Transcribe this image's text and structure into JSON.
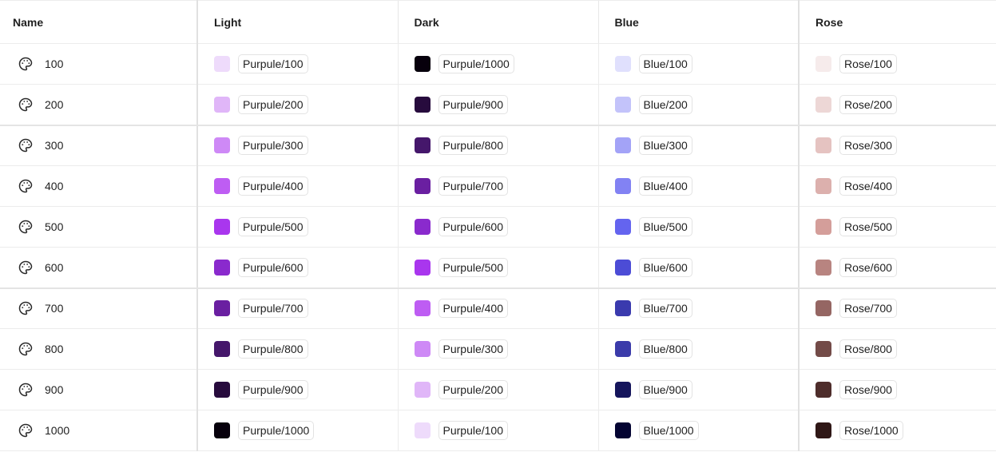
{
  "headers": [
    "Name",
    "Light",
    "Dark",
    "Blue",
    "Rose"
  ],
  "icon": "palette-icon",
  "rows": [
    {
      "name": "100",
      "light": {
        "label": "Purpule/100",
        "color": "#EEDBFB"
      },
      "dark": {
        "label": "Purpule/1000",
        "color": "#07000C"
      },
      "blue": {
        "label": "Blue/100",
        "color": "#E0E0FD"
      },
      "rose": {
        "label": "Rose/100",
        "color": "#F6EBEB"
      }
    },
    {
      "name": "200",
      "light": {
        "label": "Purpule/200",
        "color": "#E0B6F8"
      },
      "dark": {
        "label": "Purpule/900",
        "color": "#270B3D"
      },
      "blue": {
        "label": "Blue/200",
        "color": "#C3C3FA"
      },
      "rose": {
        "label": "Rose/200",
        "color": "#EDD7D6"
      }
    },
    {
      "name": "300",
      "light": {
        "label": "Purpule/300",
        "color": "#CE89F6"
      },
      "dark": {
        "label": "Purpule/800",
        "color": "#45176B"
      },
      "blue": {
        "label": "Blue/300",
        "color": "#A3A3F7"
      },
      "rose": {
        "label": "Rose/300",
        "color": "#E5C3C1"
      }
    },
    {
      "name": "400",
      "light": {
        "label": "Purpule/400",
        "color": "#BE5DF3"
      },
      "dark": {
        "label": "Purpule/700",
        "color": "#6A1FA1"
      },
      "blue": {
        "label": "Blue/400",
        "color": "#8282F3"
      },
      "rose": {
        "label": "Rose/400",
        "color": "#DCB0AD"
      }
    },
    {
      "name": "500",
      "light": {
        "label": "Purpule/500",
        "color": "#A936EE"
      },
      "dark": {
        "label": "Purpule/600",
        "color": "#8A2ACD"
      },
      "blue": {
        "label": "Blue/500",
        "color": "#6464EF"
      },
      "rose": {
        "label": "Rose/500",
        "color": "#D49E9A"
      }
    },
    {
      "name": "600",
      "light": {
        "label": "Purpule/600",
        "color": "#8A2ACD"
      },
      "dark": {
        "label": "Purpule/500",
        "color": "#A936EE"
      },
      "blue": {
        "label": "Blue/600",
        "color": "#4C4CD6"
      },
      "rose": {
        "label": "Rose/600",
        "color": "#B88480"
      }
    },
    {
      "name": "700",
      "light": {
        "label": "Purpule/700",
        "color": "#6A1FA1"
      },
      "dark": {
        "label": "Purpule/400",
        "color": "#BE5DF3"
      },
      "blue": {
        "label": "Blue/700",
        "color": "#3A3AAE"
      },
      "rose": {
        "label": "Rose/700",
        "color": "#956663"
      }
    },
    {
      "name": "800",
      "light": {
        "label": "Purpule/800",
        "color": "#45176B"
      },
      "dark": {
        "label": "Purpule/300",
        "color": "#CE89F6"
      },
      "blue": {
        "label": "Blue/800",
        "color": "#3B3BAA"
      },
      "rose": {
        "label": "Rose/800",
        "color": "#734B48"
      }
    },
    {
      "name": "900",
      "light": {
        "label": "Purpule/900",
        "color": "#270B3D"
      },
      "dark": {
        "label": "Purpule/200",
        "color": "#E0B6F8"
      },
      "blue": {
        "label": "Blue/900",
        "color": "#15155C"
      },
      "rose": {
        "label": "Rose/900",
        "color": "#4E2D2B"
      }
    },
    {
      "name": "1000",
      "light": {
        "label": "Purpule/1000",
        "color": "#07000C"
      },
      "dark": {
        "label": "Purpule/100",
        "color": "#EEDBFB"
      },
      "blue": {
        "label": "Blue/1000",
        "color": "#040432"
      },
      "rose": {
        "label": "Rose/1000",
        "color": "#2F1716"
      }
    }
  ]
}
